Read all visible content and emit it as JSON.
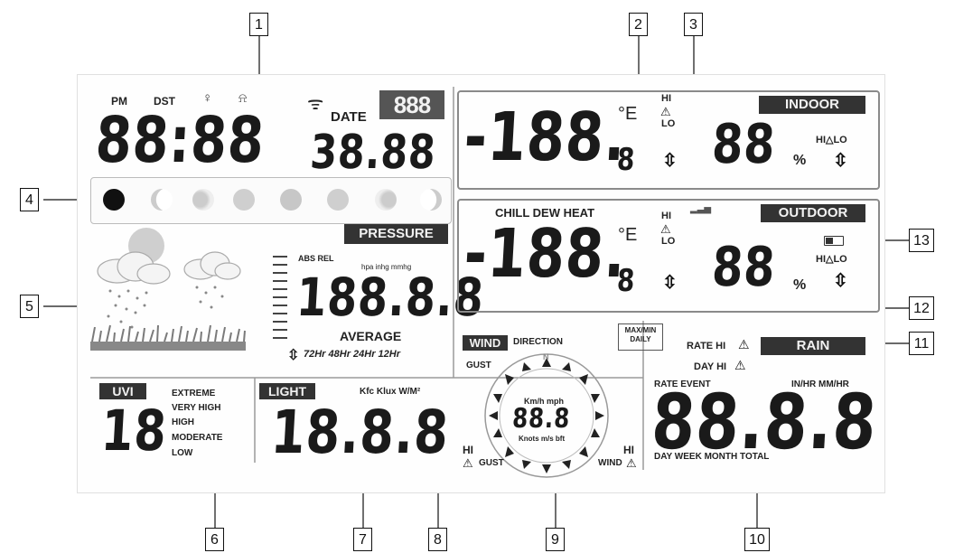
{
  "callouts": [
    "1",
    "2",
    "3",
    "4",
    "5",
    "6",
    "7",
    "8",
    "9",
    "10",
    "11",
    "12",
    "13"
  ],
  "clock": {
    "pm": "PM",
    "dst": "DST",
    "time": "88:88",
    "date_label": "DATE",
    "date_value": "38.88",
    "weekday": "888"
  },
  "pressure": {
    "label": "PRESSURE",
    "mode": "ABS REL",
    "units": "hpa inhg mmhg",
    "value": "188.8.8",
    "average": "AVERAGE",
    "periods": "72Hr 48Hr 24Hr 12Hr"
  },
  "indoor": {
    "label": "INDOOR",
    "temp": "-188.",
    "temp_decimal": "8",
    "temp_unit": "°E",
    "hi": "HI",
    "lo": "LO",
    "hum": "88",
    "hum_unit": "%",
    "hi_lo": "HI△LO"
  },
  "outdoor": {
    "label": "OUTDOOR",
    "modes": "CHILL DEW HEAT",
    "temp": "-188.",
    "temp_decimal": "8",
    "temp_unit": "°E",
    "hi": "HI",
    "lo": "LO",
    "hum": "88",
    "hum_unit": "%",
    "hi_lo": "HI△LO"
  },
  "uvi": {
    "label": "UVI",
    "value": "18",
    "levels": [
      "EXTREME",
      "VERY HIGH",
      "HIGH",
      "MODERATE",
      "LOW"
    ]
  },
  "light": {
    "label": "LIGHT",
    "units": "Kfc Klux W/M²",
    "value": "18.8.8"
  },
  "wind": {
    "label": "WIND",
    "direction": "DIRECTION",
    "maxmin_1": "MAX/MIN",
    "maxmin_2": "DAILY",
    "gust": "GUST",
    "speed_units_top": "Km/h mph",
    "speed_value": "88.8",
    "speed_units_bottom": "Knots m/s bft",
    "compass_n": "N",
    "hi_left": "HI",
    "gust_left": "GUST",
    "hi_right": "HI",
    "wind_right": "WIND"
  },
  "rain": {
    "label": "RAIN",
    "rate_hi": "RATE HI",
    "day_hi": "DAY HI",
    "rate_event": "RATE EVENT",
    "units": "IN/HR MM/HR",
    "value": "88.8.8",
    "periods": "DAY WEEK MONTH TOTAL"
  },
  "colors": {
    "lcd_ink": "#1a1a1a",
    "reverse_bg": "#333333",
    "panel_border": "#8a8a8a"
  }
}
